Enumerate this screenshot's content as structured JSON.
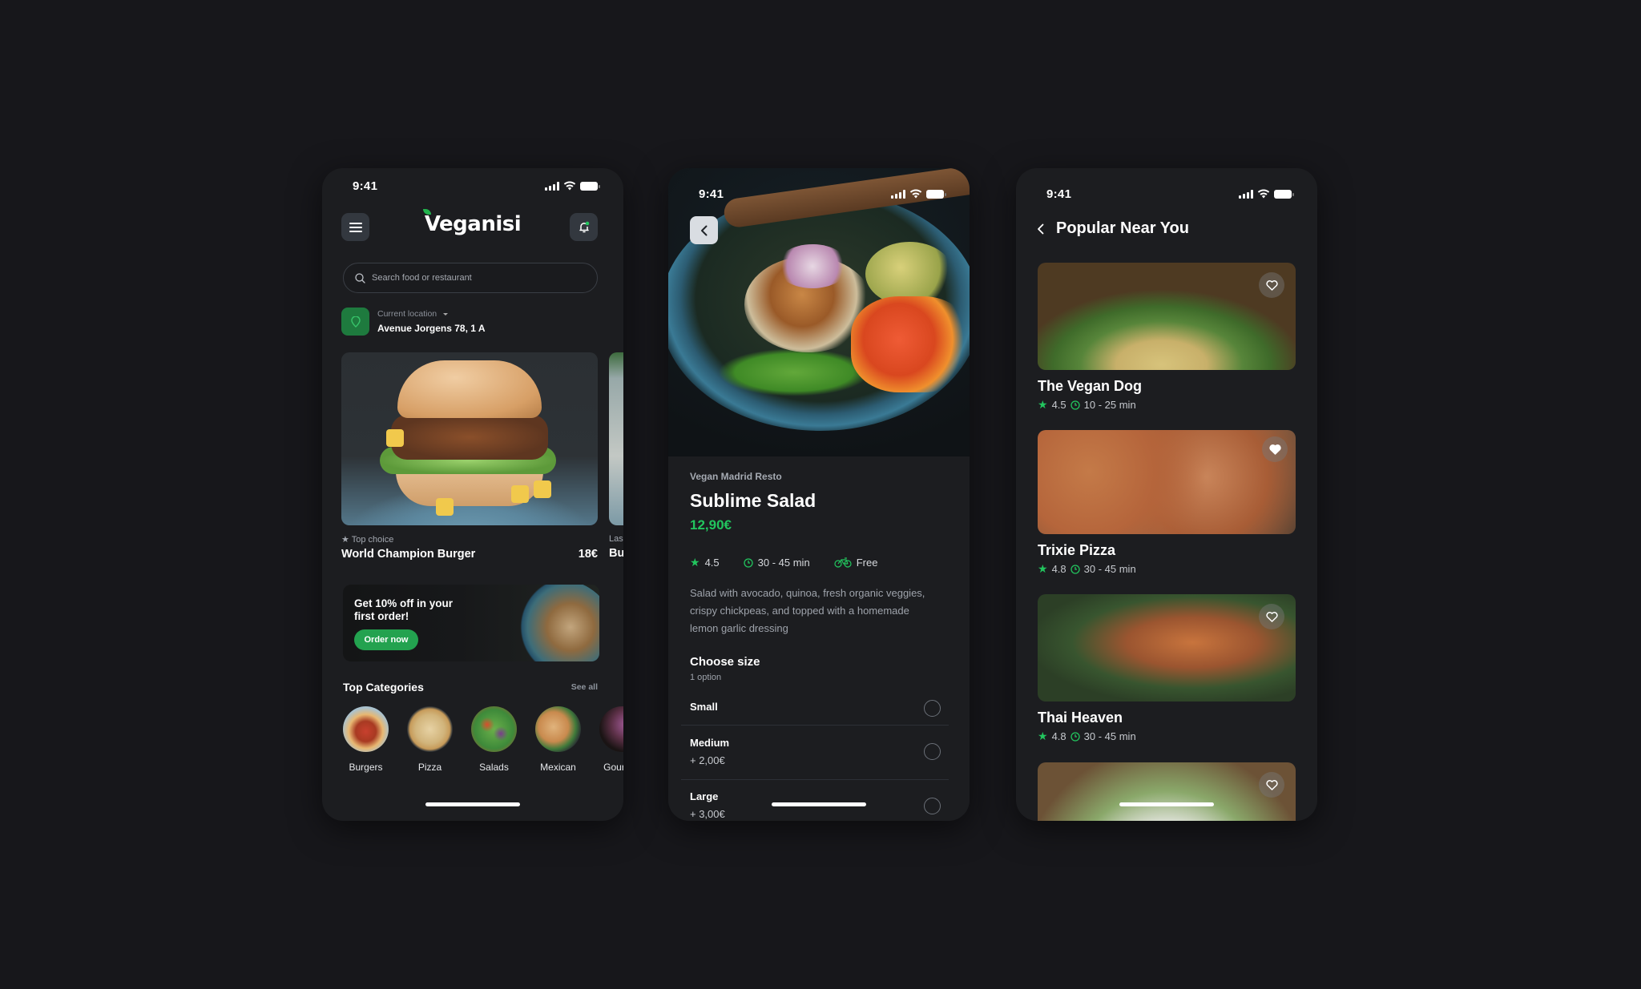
{
  "screens": {
    "home": {
      "status_time": "9:41",
      "brand": "Veganisi",
      "menu_icon": "hamburger-menu-icon",
      "notification_icon": "bell-icon",
      "search": {
        "placeholder": "Search food or restaurant",
        "value": ""
      },
      "location": {
        "label": "Current location",
        "address": "Avenue Jorgens 78, 1 A"
      },
      "featured": [
        {
          "tag": "★ Top choice",
          "name": "World Champion Burger",
          "price": "18€"
        },
        {
          "tag": "Las",
          "name": "Bu",
          "price": ""
        }
      ],
      "promo": {
        "title": "Get 10% off in your first order!",
        "button": "Order now"
      },
      "categories_title": "Top Categories",
      "see_all": "See all",
      "categories": [
        "Burgers",
        "Pizza",
        "Salads",
        "Mexican",
        "Gourmet"
      ]
    },
    "detail": {
      "status_time": "9:41",
      "back_icon": "chevron-left-icon",
      "restaurant": "Vegan Madrid Resto",
      "title": "Sublime Salad",
      "price": "12,90€",
      "rating": "4.5",
      "time": "30 - 45 min",
      "delivery": "Free",
      "description": "Salad with avocado, quinoa, fresh organic veggies, crispy chickpeas, and topped with a homemade lemon garlic dressing",
      "size_title": "Choose size",
      "size_sub": "1 option",
      "sizes": [
        {
          "label": "Small",
          "price": "",
          "selected": false
        },
        {
          "label": "Medium",
          "price": "+ 2,00€",
          "selected": false
        },
        {
          "label": "Large",
          "price": "+ 3,00€",
          "selected": false
        }
      ]
    },
    "popular": {
      "status_time": "9:41",
      "title": "Popular Near You",
      "restaurants": [
        {
          "name": "The Vegan Dog",
          "rating": "4.5",
          "time": "10 - 25 min",
          "favorite": false
        },
        {
          "name": "Trixie Pizza",
          "rating": "4.8",
          "time": "30 - 45 min",
          "favorite": true
        },
        {
          "name": "Thai Heaven",
          "rating": "4.8",
          "time": "30 - 45 min",
          "favorite": false
        },
        {
          "name": "",
          "rating": "",
          "time": "",
          "favorite": false
        }
      ]
    }
  },
  "colors": {
    "background": "#17171b",
    "phone": "#1c1d20",
    "accent_green": "#22c55e",
    "button_green": "#23a24f",
    "location_green": "#1e7a3e",
    "icon_button": "#33383f"
  }
}
